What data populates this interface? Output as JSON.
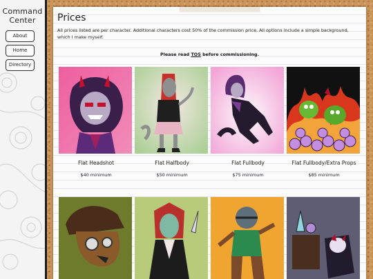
{
  "sidebar": {
    "title_line1": "Command",
    "title_line2": "Center",
    "nav": [
      {
        "label": "About"
      },
      {
        "label": "Home"
      },
      {
        "label": "Directory"
      }
    ]
  },
  "page": {
    "title": "Prices",
    "intro": "All prices listed are per character. Additional characters cost 50% of the commission price. All options include a simple background, which I make myself.",
    "tos_prefix": "Please read ",
    "tos_link": "TOS",
    "tos_suffix": " before commissioning."
  },
  "price_cards": [
    {
      "name": "Flat Headshot",
      "price": "$40 minimum"
    },
    {
      "name": "Flat Halfbody",
      "price": "$50 minimum"
    },
    {
      "name": "Flat Fullbody",
      "price": "$75 minimum"
    },
    {
      "name": "Flat Fullbody/Extra Props",
      "price": "$85 minimum"
    }
  ],
  "colors": {
    "corkboard": "#c9955a",
    "sidebar_border": "#1a1a1a",
    "paper": "#fbfbfb",
    "ruled_line": "#e6e6ec"
  }
}
